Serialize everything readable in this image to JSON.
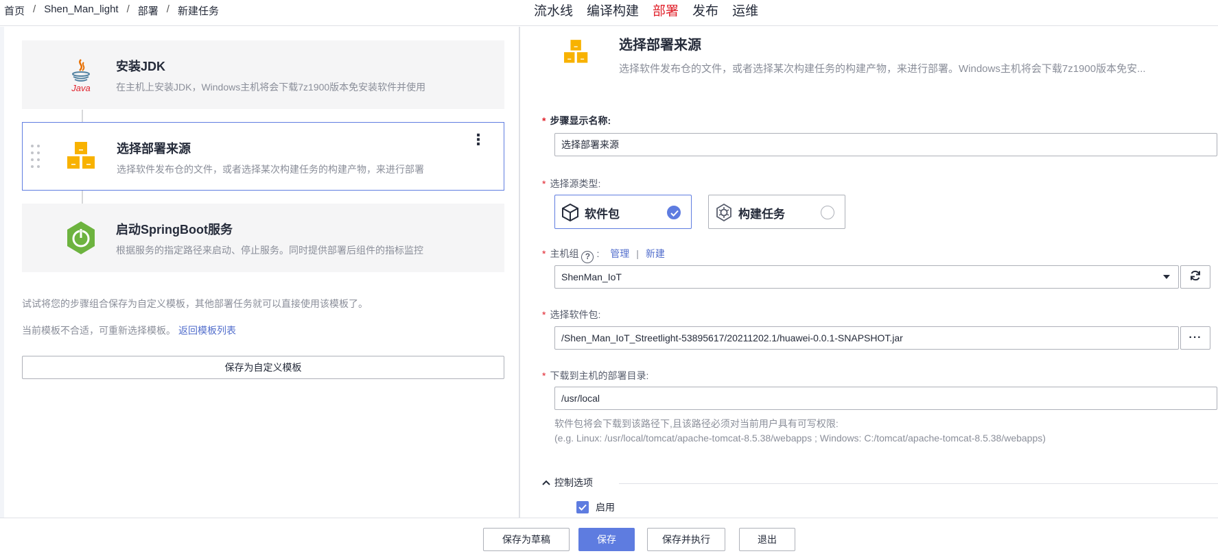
{
  "breadcrumb": [
    "首页",
    "Shen_Man_light",
    "部署",
    "新建任务"
  ],
  "topnav": {
    "pipeline": "流水线",
    "build": "编译构建",
    "deploy": "部署",
    "release": "发布",
    "ops": "运维"
  },
  "steps": [
    {
      "title": "安装JDK",
      "desc": "在主机上安装JDK，Windows主机将会下载7z1900版本免安装软件并使用"
    },
    {
      "title": "选择部署来源",
      "desc": "选择软件发布仓的文件，或者选择某次构建任务的构建产物，来进行部署"
    },
    {
      "title": "启动SpringBoot服务",
      "desc": "根据服务的指定路径来启动、停止服务。同时提供部署后组件的指标监控"
    }
  ],
  "tips": {
    "template_tip": "试试将您的步骤组合保存为自定义模板，其他部署任务就可以直接使用该模板了。",
    "reselect_tip": "当前模板不合适，可重新选择模板。",
    "back_link": "返回模板列表",
    "save_template": "保存为自定义模板"
  },
  "detail": {
    "title": "选择部署来源",
    "desc": "选择软件发布仓的文件，或者选择某次构建任务的构建产物，来进行部署。Windows主机将会下载7z1900版本免安...",
    "step_name_label": "步骤显示名称:",
    "step_name_value": "选择部署来源",
    "source_type_label": "选择源类型:",
    "source_types": [
      "软件包",
      "构建任务"
    ],
    "host_group_label": "主机组",
    "manage_link": "管理",
    "new_link": "新建",
    "host_group_value": "ShenMan_IoT",
    "package_label": "选择软件包:",
    "package_value": "/Shen_Man_IoT_Streetlight-53895617/20211202.1/huawei-0.0.1-SNAPSHOT.jar",
    "browse_label": "···",
    "dir_label": "下载到主机的部署目录:",
    "dir_value": "/usr/local",
    "hint1": "软件包将会下载到该路径下,且该路径必须对当前用户具有可写权限:",
    "hint2": "(e.g. Linux: /usr/local/tomcat/apache-tomcat-8.5.38/webapps ; Windows: C:/tomcat/apache-tomcat-8.5.38/webapps)",
    "control_options": "控制选项",
    "enable_label": "启用"
  },
  "footer": {
    "draft": "保存为草稿",
    "save": "保存",
    "save_run": "保存并执行",
    "exit": "退出"
  },
  "colors": {
    "accent": "#5e7ce0",
    "active_nav": "#e0202a",
    "required": "#e0202a",
    "link": "#526ecc"
  }
}
